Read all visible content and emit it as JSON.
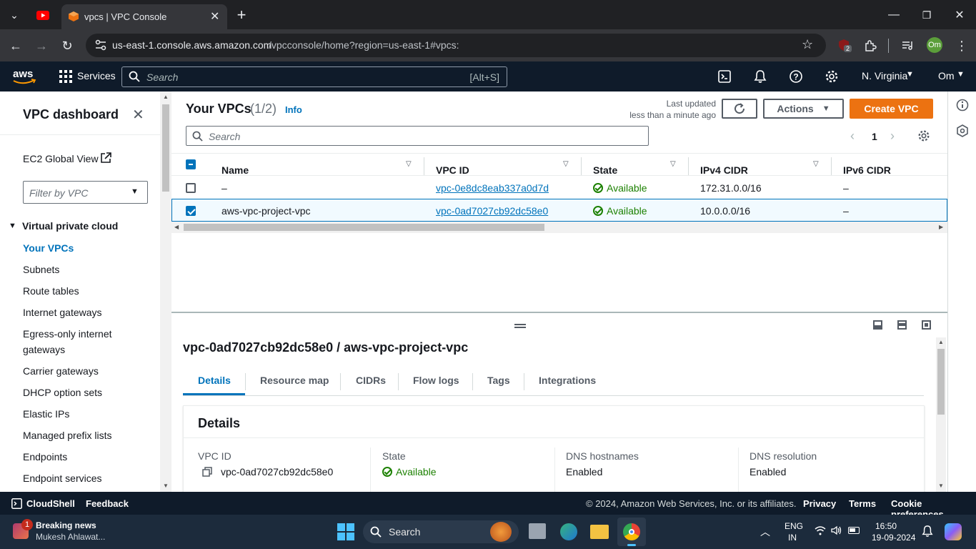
{
  "browser": {
    "tab_title": "vpcs | VPC Console",
    "url_host": "us-east-1.console.aws.amazon.com",
    "url_path": "/vpcconsole/home?region=us-east-1#vpcs:",
    "extension_badge": "2",
    "profile_initials": "Om"
  },
  "aws_nav": {
    "services_label": "Services",
    "search_placeholder": "Search",
    "search_shortcut": "[Alt+S]",
    "region_label": "N. Virginia",
    "user_label": "Om"
  },
  "sidebar": {
    "title": "VPC dashboard",
    "ec2_global_view": "EC2 Global View",
    "filter_placeholder": "Filter by VPC",
    "section_title": "Virtual private cloud",
    "items": [
      {
        "label": "Your VPCs"
      },
      {
        "label": "Subnets"
      },
      {
        "label": "Route tables"
      },
      {
        "label": "Internet gateways"
      },
      {
        "label": "Egress-only internet"
      },
      {
        "label": "gateways"
      },
      {
        "label": "Carrier gateways"
      },
      {
        "label": "DHCP option sets"
      },
      {
        "label": "Elastic IPs"
      },
      {
        "label": "Managed prefix lists"
      },
      {
        "label": "Endpoints"
      },
      {
        "label": "Endpoint services"
      }
    ]
  },
  "vpc_list": {
    "title": "Your VPCs",
    "count": "(1/2)",
    "info_label": "Info",
    "last_updated_label": "Last updated",
    "last_updated_value": "less than a minute ago",
    "actions_label": "Actions",
    "create_label": "Create VPC",
    "search_placeholder": "Search",
    "page_number": "1",
    "columns": [
      "Name",
      "VPC ID",
      "State",
      "IPv4 CIDR",
      "IPv6 CIDR"
    ],
    "rows": [
      {
        "name": "–",
        "vpc_id": "vpc-0e8dc8eab337a0d7d",
        "state": "Available",
        "ipv4": "172.31.0.0/16",
        "ipv6": "–",
        "selected": false
      },
      {
        "name": "aws-vpc-project-vpc",
        "vpc_id": "vpc-0ad7027cb92dc58e0",
        "state": "Available",
        "ipv4": "10.0.0.0/16",
        "ipv6": "–",
        "selected": true
      }
    ]
  },
  "detail": {
    "heading": "vpc-0ad7027cb92dc58e0 / aws-vpc-project-vpc",
    "tabs": [
      "Details",
      "Resource map",
      "CIDRs",
      "Flow logs",
      "Tags",
      "Integrations"
    ],
    "section_title": "Details",
    "fields": [
      {
        "label": "VPC ID",
        "value": "vpc-0ad7027cb92dc58e0"
      },
      {
        "label": "State",
        "value": "Available"
      },
      {
        "label": "DNS hostnames",
        "value": "Enabled"
      },
      {
        "label": "DNS resolution",
        "value": "Enabled"
      }
    ]
  },
  "footer": {
    "cloudshell": "CloudShell",
    "feedback": "Feedback",
    "copyright": "© 2024, Amazon Web Services, Inc. or its affiliates.",
    "privacy": "Privacy",
    "terms": "Terms",
    "cookie": "Cookie preferences"
  },
  "taskbar": {
    "news_badge": "1",
    "news_title": "Breaking news",
    "news_subtitle": "Mukesh Ahlawat...",
    "search_label": "Search",
    "lang_line1": "ENG",
    "lang_line2": "IN",
    "time": "16:50",
    "date": "19-09-2024"
  },
  "colors": {
    "aws_nav_bg": "#0f1b2a",
    "accent_orange": "#ec7211",
    "link_blue": "#0073bb",
    "success_green": "#1d8102"
  }
}
